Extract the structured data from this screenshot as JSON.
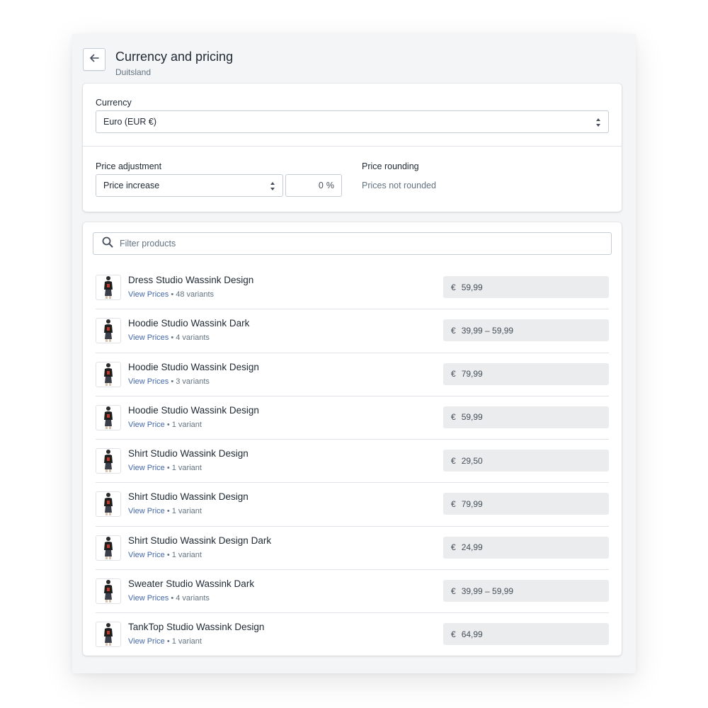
{
  "header": {
    "title": "Currency and pricing",
    "subtitle": "Duitsland"
  },
  "currency": {
    "label": "Currency",
    "value": "Euro (EUR €)"
  },
  "price_adjustment": {
    "label": "Price adjustment",
    "type_value": "Price increase",
    "percent_value": "0",
    "percent_suffix": "%"
  },
  "price_rounding": {
    "label": "Price rounding",
    "value": "Prices not rounded"
  },
  "search": {
    "placeholder": "Filter products"
  },
  "products": [
    {
      "name": "Dress Studio Wassink Design",
      "link": "View Prices",
      "variants": "• 48 variants",
      "currency": "€",
      "price": "59,99"
    },
    {
      "name": "Hoodie Studio Wassink Dark",
      "link": "View Prices",
      "variants": "• 4 variants",
      "currency": "€",
      "price": "39,99 – 59,99"
    },
    {
      "name": "Hoodie Studio Wassink Design",
      "link": "View Prices",
      "variants": "• 3 variants",
      "currency": "€",
      "price": "79,99"
    },
    {
      "name": "Hoodie Studio Wassink Design",
      "link": "View Price",
      "variants": "• 1 variant",
      "currency": "€",
      "price": "59,99"
    },
    {
      "name": "Shirt Studio Wassink Design",
      "link": "View Price",
      "variants": "• 1 variant",
      "currency": "€",
      "price": "29,50"
    },
    {
      "name": "Shirt Studio Wassink Design",
      "link": "View Price",
      "variants": "• 1 variant",
      "currency": "€",
      "price": "79,99"
    },
    {
      "name": "Shirt Studio Wassink Design Dark",
      "link": "View Price",
      "variants": "• 1 variant",
      "currency": "€",
      "price": "24,99"
    },
    {
      "name": "Sweater Studio Wassink Dark",
      "link": "View Prices",
      "variants": "• 4 variants",
      "currency": "€",
      "price": "39,99 – 59,99"
    },
    {
      "name": "TankTop Studio Wassink Design",
      "link": "View Price",
      "variants": "• 1 variant",
      "currency": "€",
      "price": "64,99"
    }
  ],
  "icons": {
    "back": "arrow-left-icon",
    "select": "select-arrows-icon",
    "search": "search-icon",
    "product": "product-thumbnail"
  },
  "colors": {
    "background": "#f4f5f7",
    "link": "#4468a8",
    "price_box": "#ebeced",
    "border": "#c4cdd5"
  }
}
